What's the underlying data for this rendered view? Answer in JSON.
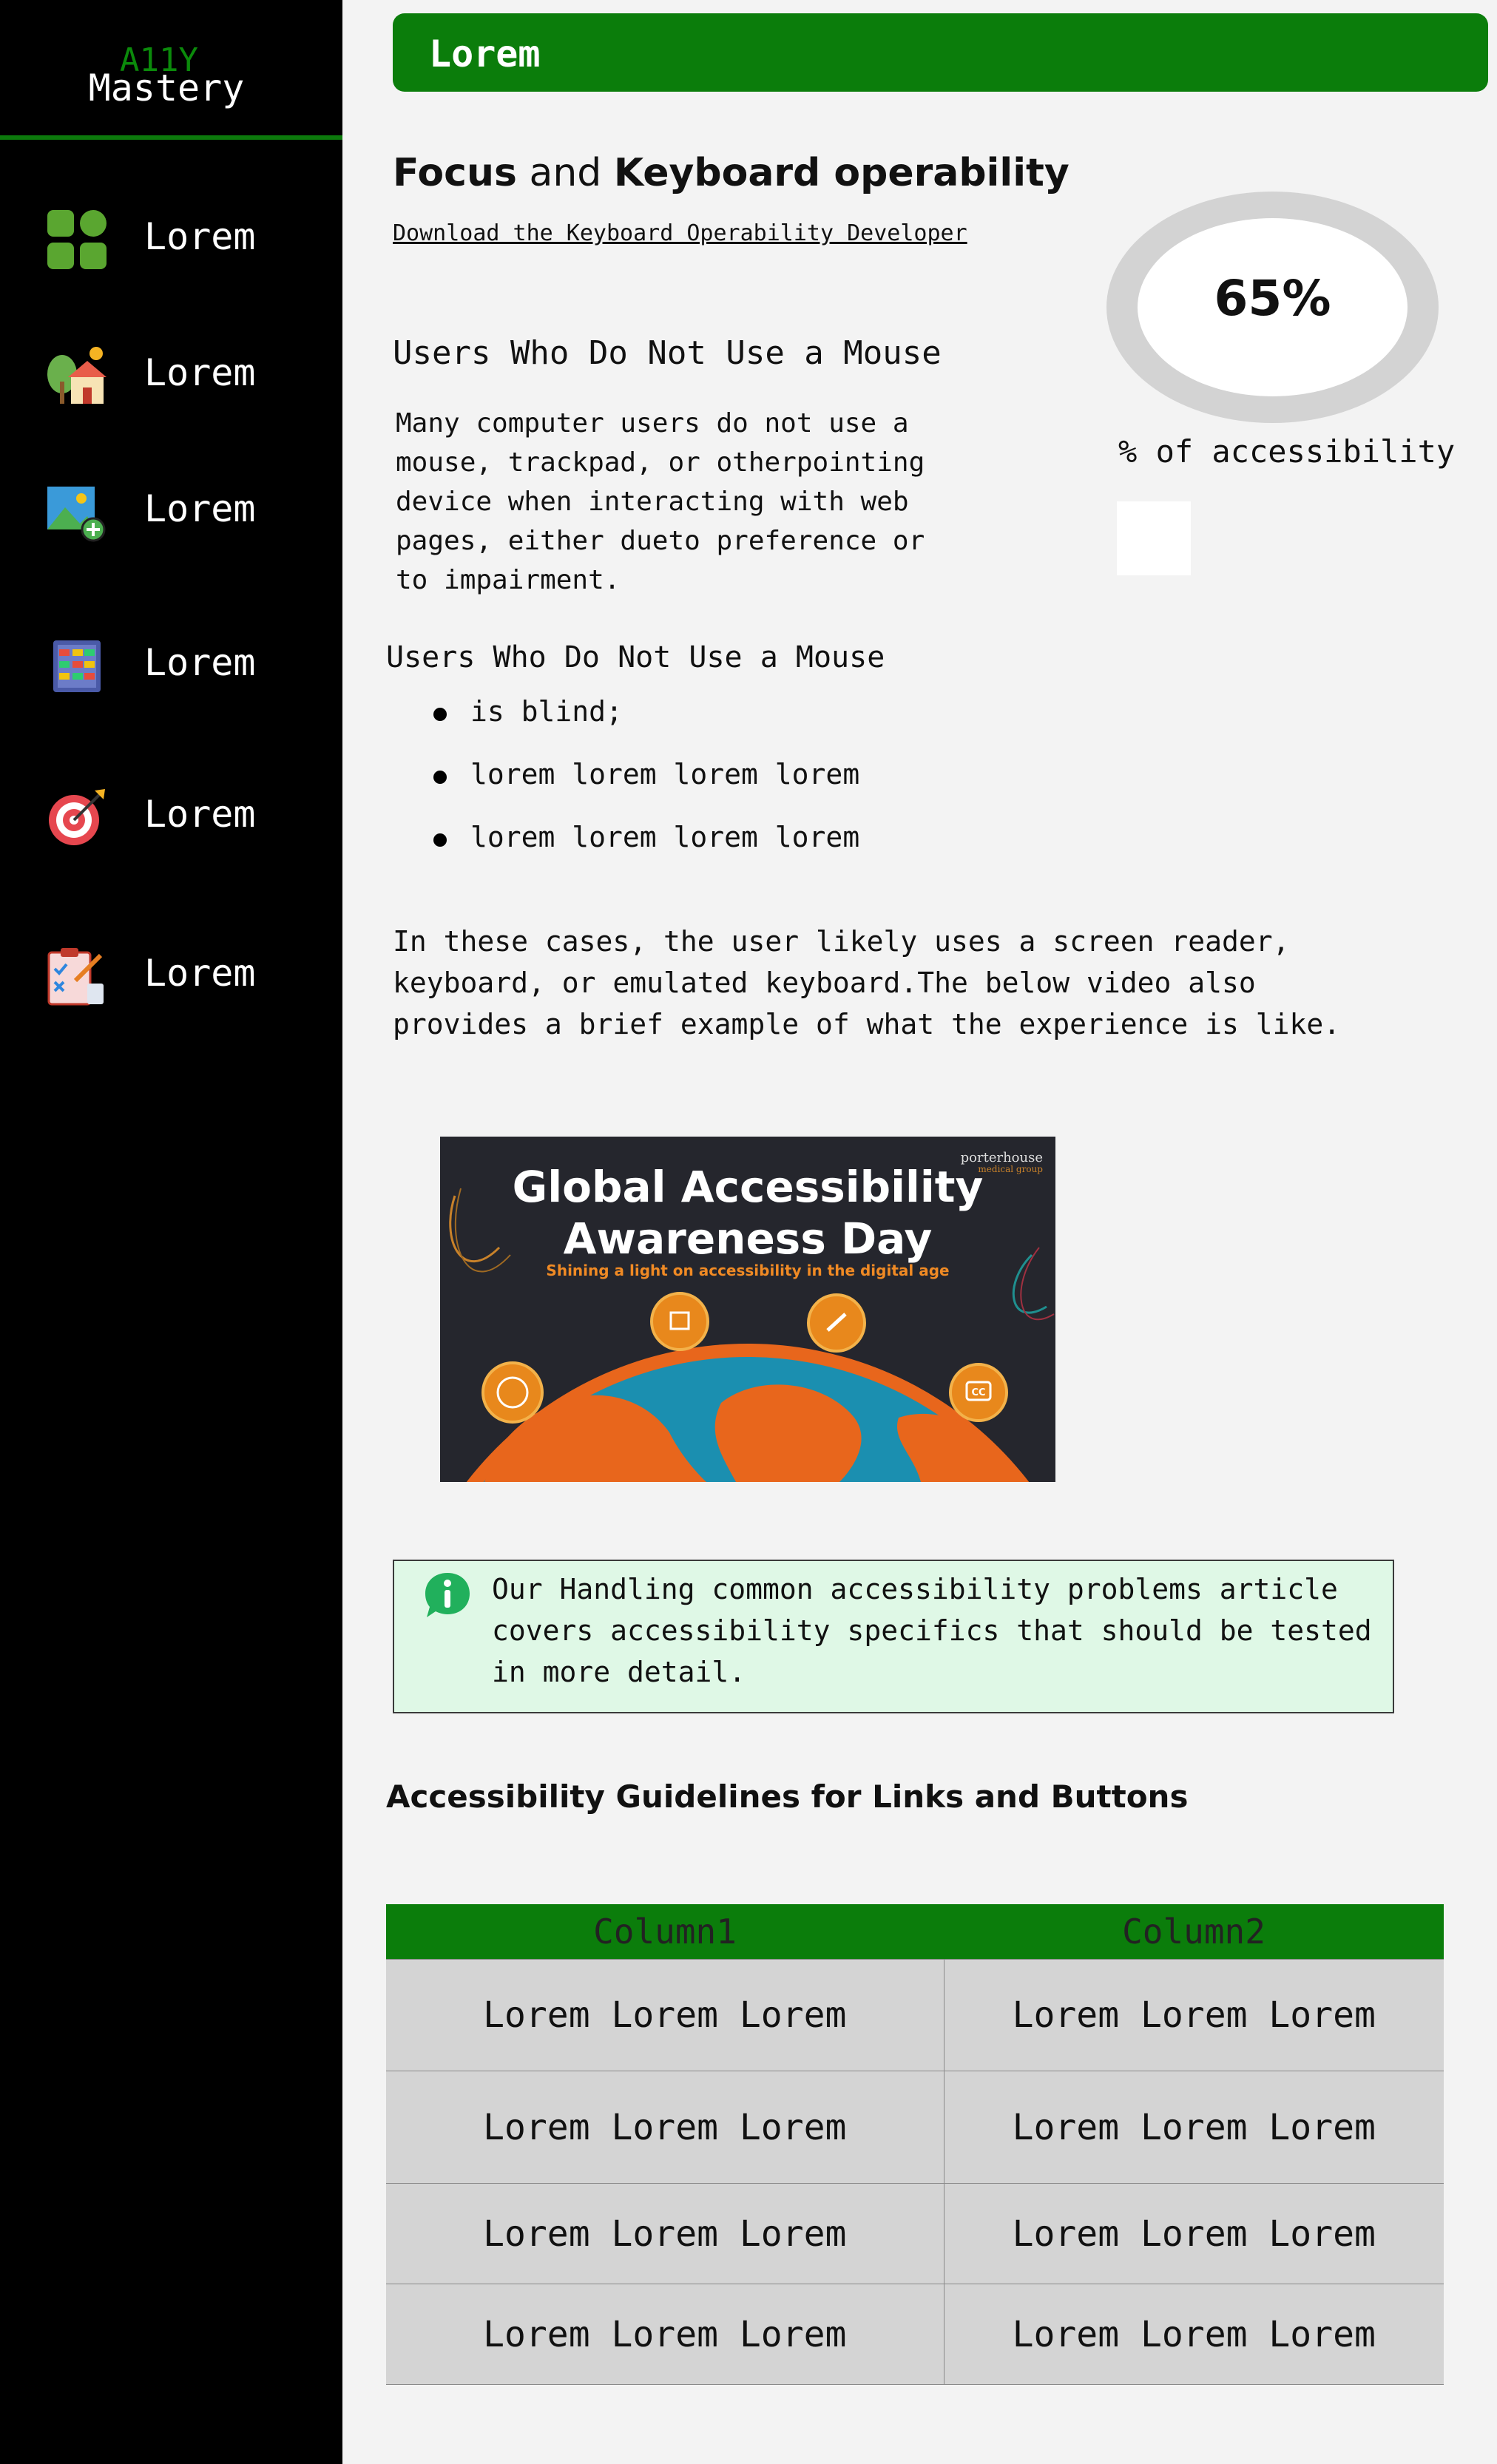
{
  "sidebar": {
    "logo_top": "A11Y",
    "logo_main": "Mastery",
    "items": [
      {
        "label": "Lorem",
        "icon": "grid-icon"
      },
      {
        "label": "Lorem",
        "icon": "house-icon"
      },
      {
        "label": "Lorem",
        "icon": "add-image-icon"
      },
      {
        "label": "Lorem",
        "icon": "abacus-icon"
      },
      {
        "label": "Lorem",
        "icon": "target-icon"
      },
      {
        "label": "Lorem",
        "icon": "clipboard-checklist-icon"
      }
    ]
  },
  "header": {
    "title": "Lorem",
    "bg_color": "#0b7d0b"
  },
  "main": {
    "title_part1": "Focus",
    "title_part2": " and ",
    "title_part3": "Keyboard operability",
    "download_link": "Download the Keyboard Operability Developer",
    "section1_heading": "Users Who Do Not Use a Mouse",
    "section1_para": "Many computer users do not use a mouse, trackpad, or otherpointing device when interacting with web pages, either dueto preference or to impairment.",
    "section2_heading": "Users Who Do Not Use a Mouse",
    "bullets": [
      "is blind;",
      "lorem lorem lorem lorem",
      "lorem lorem lorem lorem"
    ],
    "cases_para": "In these cases, the user likely uses a screen reader, keyboard, or emulated keyboard.The below video also provides a brief example of what the experience is like.",
    "info_text": "Our Handling common accessibility problems article covers accessibility specifics that should be tested in more detail.",
    "guidelines_heading": "Accessibility Guidelines for Links and Buttons"
  },
  "gauge": {
    "value_text": "65%",
    "value": 65,
    "caption": "% of accessibility"
  },
  "banner": {
    "title_line1": "Global Accessibility",
    "title_line2": "Awareness Day",
    "subtitle": "Shining a light on accessibility in the digital age",
    "brand1": "porterhouse",
    "brand2": "medical group",
    "cc_label": "CC"
  },
  "table": {
    "headers": [
      "Column1",
      "Column2"
    ],
    "rows": [
      [
        "Lorem Lorem Lorem",
        "Lorem Lorem Lorem"
      ],
      [
        "Lorem Lorem Lorem",
        "Lorem Lorem Lorem"
      ],
      [
        "Lorem Lorem Lorem",
        "Lorem Lorem Lorem"
      ],
      [
        "Lorem Lorem Lorem",
        "Lorem Lorem Lorem"
      ]
    ]
  }
}
